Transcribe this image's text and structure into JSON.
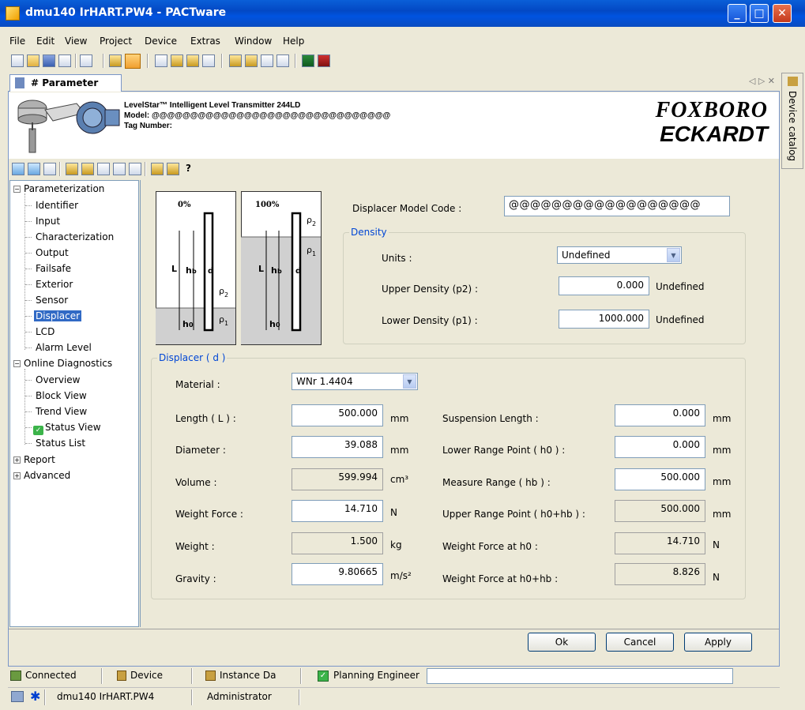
{
  "window": {
    "title": "dmu140 IrHART.PW4 - PACTware",
    "min_label": "_",
    "max_label": "□",
    "close_label": "✕"
  },
  "menu": [
    "File",
    "Edit",
    "View",
    "Project",
    "Device",
    "Extras",
    "Window",
    "Help"
  ],
  "tab": {
    "label": "# Parameter",
    "nav": "◁ ▷ ✕"
  },
  "header": {
    "product": "LevelStar™ Intelligent Level Transmitter 244LD",
    "model": "Model: @@@@@@@@@@@@@@@@@@@@@@@@@@@@@@@",
    "tag": "Tag Number:",
    "logo_line1": "FOXBORO",
    "logo_line2": "ECKARDT"
  },
  "toolbar2": {
    "help_label": "?"
  },
  "tree": {
    "parameterization": "Parameterization",
    "param_items": [
      "Identifier",
      "Input",
      "Characterization",
      "Output",
      "Failsafe",
      "Exterior",
      "Sensor",
      "Displacer",
      "LCD",
      "Alarm Level"
    ],
    "online": "Online Diagnostics",
    "online_items": [
      "Overview",
      "Block View",
      "Trend View",
      "Status View",
      "Status List"
    ],
    "report": "Report",
    "advanced": "Advanced",
    "collapse": "−",
    "expand": "+"
  },
  "diagram": {
    "left_label": "0%",
    "right_label": "100%",
    "L": "L",
    "hb": "h",
    "hb_sub": "b",
    "h0": "h",
    "h0_sub": "0",
    "d": "d",
    "rho": "ρ",
    "sub1": "1",
    "sub2": "2"
  },
  "model_code": {
    "label": "Displacer Model Code :",
    "value": "@@@@@@@@@@@@@@@@@@"
  },
  "density": {
    "title": "Density",
    "units_label": "Units :",
    "units_value": "Undefined",
    "upper_label": "Upper Density (p2) :",
    "upper_value": "0.000",
    "upper_unit": "Undefined",
    "lower_label": "Lower Density (p1) :",
    "lower_value": "1000.000",
    "lower_unit": "Undefined"
  },
  "displacer": {
    "title": "Displacer ( d )",
    "material_label": "Material :",
    "material_value": "WNr 1.4404",
    "left": [
      {
        "label": "Length ( L ) :",
        "value": "500.000",
        "unit": "mm",
        "ro": false
      },
      {
        "label": "Diameter :",
        "value": "39.088",
        "unit": "mm",
        "ro": false
      },
      {
        "label": "Volume :",
        "value": "599.994",
        "unit": "cm³",
        "ro": true
      },
      {
        "label": "Weight Force :",
        "value": "14.710",
        "unit": "N",
        "ro": false
      },
      {
        "label": "Weight :",
        "value": "1.500",
        "unit": "kg",
        "ro": true
      },
      {
        "label": "Gravity :",
        "value": "9.80665",
        "unit": "m/s²",
        "ro": false
      }
    ],
    "right": [
      {
        "label": "Suspension Length :",
        "value": "0.000",
        "unit": "mm",
        "ro": false
      },
      {
        "label": "Lower Range Point ( h0 ) :",
        "value": "0.000",
        "unit": "mm",
        "ro": false
      },
      {
        "label": "Measure Range ( hb ) :",
        "value": "500.000",
        "unit": "mm",
        "ro": false
      },
      {
        "label": "Upper Range Point ( h0+hb ) :",
        "value": "500.000",
        "unit": "mm",
        "ro": true
      },
      {
        "label": "Weight Force at h0 :",
        "value": "14.710",
        "unit": "N",
        "ro": true
      },
      {
        "label": "Weight Force at h0+hb :",
        "value": "8.826",
        "unit": "N",
        "ro": true
      }
    ]
  },
  "buttons": {
    "ok": "Ok",
    "cancel": "Cancel",
    "apply": "Apply"
  },
  "status": {
    "connected": "Connected",
    "device": "Device",
    "instance": "Instance Da",
    "role": "Planning Engineer"
  },
  "taskbar": {
    "project": "dmu140 IrHART.PW4",
    "user": "Administrator",
    "star": "✱"
  },
  "dock": {
    "label": "Device catalog"
  }
}
